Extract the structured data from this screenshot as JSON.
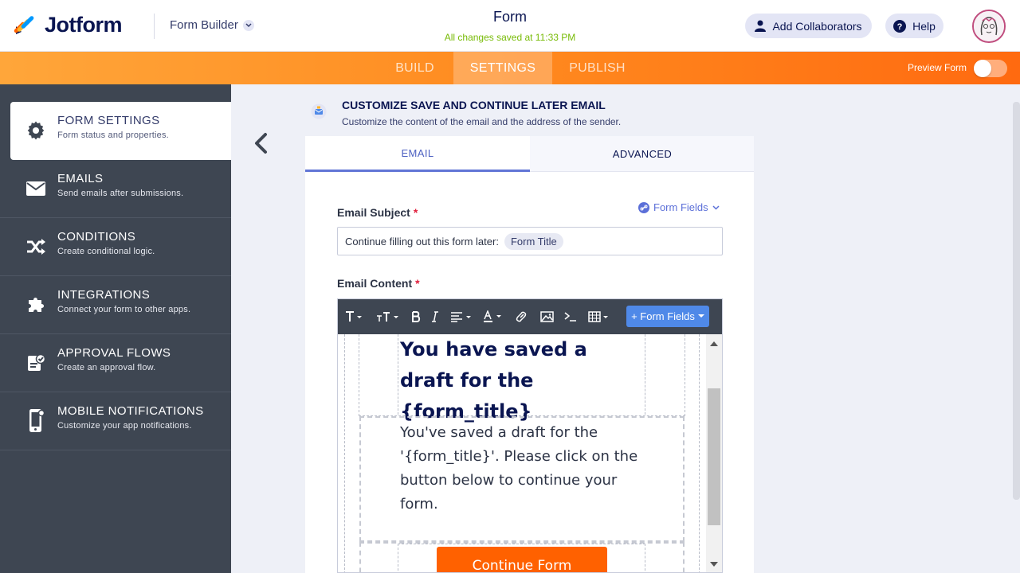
{
  "header": {
    "brand": "Jotform",
    "builder_menu": "Form Builder",
    "form_title": "Form",
    "save_status": "All changes saved at 11:33 PM",
    "add_collaborators": "Add Collaborators",
    "help": "Help"
  },
  "nav": {
    "tabs": [
      "BUILD",
      "SETTINGS",
      "PUBLISH"
    ],
    "active_tab": "SETTINGS",
    "preview_label": "Preview Form"
  },
  "sidebar": {
    "items": [
      {
        "title": "FORM SETTINGS",
        "subtitle": "Form status and properties.",
        "icon": "gear-icon"
      },
      {
        "title": "EMAILS",
        "subtitle": "Send emails after submissions.",
        "icon": "envelope-icon"
      },
      {
        "title": "CONDITIONS",
        "subtitle": "Create conditional logic.",
        "icon": "shuffle-icon"
      },
      {
        "title": "INTEGRATIONS",
        "subtitle": "Connect your form to other apps.",
        "icon": "puzzle-icon"
      },
      {
        "title": "APPROVAL FLOWS",
        "subtitle": "Create an approval flow.",
        "icon": "approval-icon"
      },
      {
        "title": "MOBILE NOTIFICATIONS",
        "subtitle": "Customize your app notifications.",
        "icon": "mobile-icon"
      }
    ]
  },
  "section": {
    "title": "CUSTOMIZE SAVE AND CONTINUE LATER EMAIL",
    "description": "Customize the content of the email and the address of the sender."
  },
  "panel": {
    "tabs": [
      "EMAIL",
      "ADVANCED"
    ],
    "active_tab": "EMAIL",
    "subject_label": "Email Subject",
    "required_mark": "*",
    "form_fields_link": "Form Fields",
    "subject_text": "Continue filling out this form later:",
    "subject_chip": "Form Title",
    "content_label": "Email Content",
    "toolbar_form_fields": "+ Form Fields",
    "email_heading": "You have saved a draft for the {form_title}",
    "email_body": "You've saved a draft for the '{form_title}'. Please click on the button below to continue your form.",
    "continue_button": "Continue Form"
  },
  "colors": {
    "brand_orange": "#ff6100",
    "navy": "#0a1551",
    "sidebar_bg": "#3e4652",
    "accent_blue": "#4f89e8",
    "saved_green": "#78bb07"
  }
}
